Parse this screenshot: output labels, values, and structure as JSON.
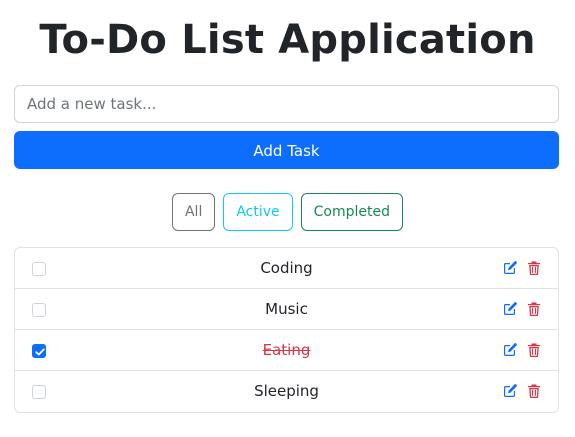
{
  "header": {
    "title": "To-Do List Application"
  },
  "new_task": {
    "placeholder": "Add a new task...",
    "value": ""
  },
  "add_button": {
    "label": "Add Task"
  },
  "filters": {
    "all": "All",
    "active": "Active",
    "completed": "Completed"
  },
  "tasks": [
    {
      "text": "Coding",
      "completed": false
    },
    {
      "text": "Music",
      "completed": false
    },
    {
      "text": "Eating",
      "completed": true
    },
    {
      "text": "Sleeping",
      "completed": false
    }
  ],
  "colors": {
    "primary": "#0d6efd",
    "all_filter": "#6c757d",
    "active_filter": "#0dcaf0",
    "completed_filter": "#198754",
    "edit_icon": "#0d6efd",
    "delete_icon": "#dc3545",
    "completed_text": "#dc3545"
  },
  "icons": {
    "edit": "pencil-square-icon",
    "delete": "trash-icon",
    "check": "checkmark-icon"
  }
}
